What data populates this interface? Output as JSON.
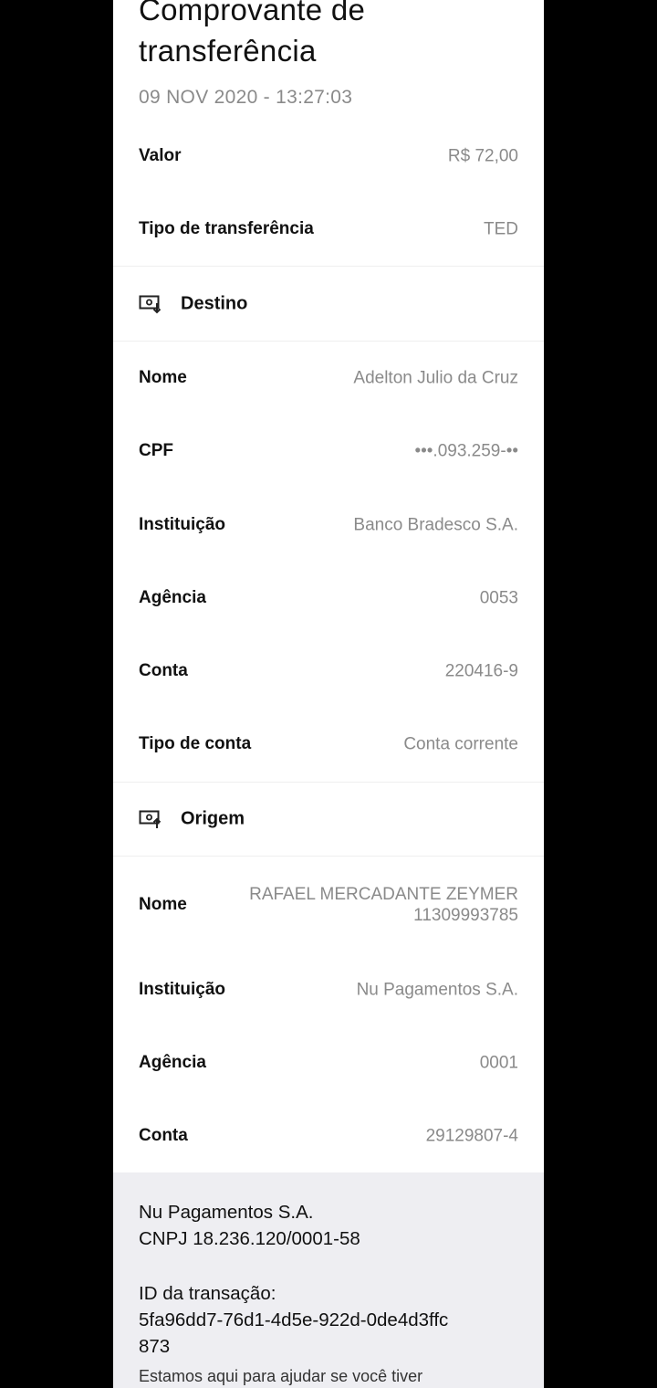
{
  "header": {
    "title": "Comprovante de transferência",
    "timestamp": "09 NOV 2020 - 13:27:03"
  },
  "summary": [
    {
      "label": "Valor",
      "value": "R$ 72,00"
    },
    {
      "label": "Tipo de transferência",
      "value": "TED"
    }
  ],
  "destino": {
    "title": "Destino",
    "icon": "bank-in-icon",
    "rows": [
      {
        "label": "Nome",
        "value": "Adelton Julio da Cruz"
      },
      {
        "label": "CPF",
        "value": "•••.093.259-••"
      },
      {
        "label": "Instituição",
        "value": "Banco Bradesco S.A."
      },
      {
        "label": "Agência",
        "value": "0053"
      },
      {
        "label": "Conta",
        "value": "220416-9"
      },
      {
        "label": "Tipo de conta",
        "value": "Conta corrente"
      }
    ]
  },
  "origem": {
    "title": "Origem",
    "icon": "bank-out-icon",
    "rows": [
      {
        "label": "Nome",
        "value_line1": "RAFAEL MERCADANTE ZEYMER",
        "value_line2": "11309993785"
      },
      {
        "label": "Instituição",
        "value": "Nu Pagamentos S.A."
      },
      {
        "label": "Agência",
        "value": "0001"
      },
      {
        "label": "Conta",
        "value": "29129807-4"
      }
    ]
  },
  "footer": {
    "company": "Nu Pagamentos S.A.",
    "cnpj": "CNPJ 18.236.120/0001-58",
    "transaction_label": "ID da transação:",
    "transaction_id_line1": "5fa96dd7-76d1-4d5e-922d-0de4d3ffc",
    "transaction_id_line2": "873",
    "help_text": "Estamos aqui para ajudar se você tiver"
  },
  "colors": {
    "background": "#000000",
    "card": "#ffffff",
    "footer_bg": "#eeeef2",
    "label": "#111111",
    "value": "#8a8a8a"
  }
}
